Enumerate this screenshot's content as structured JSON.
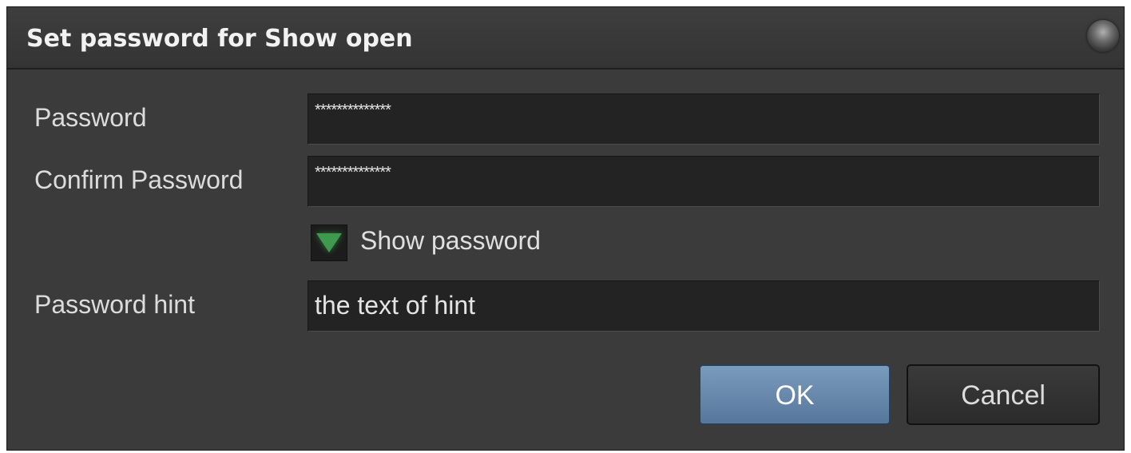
{
  "dialog": {
    "title": "Set password for Show open"
  },
  "form": {
    "password_label": "Password",
    "password_value": "**************",
    "confirm_label": "Confirm Password",
    "confirm_value": "**************",
    "show_password_label": "Show password",
    "show_password_checked": true,
    "hint_label": "Password hint",
    "hint_value": "the text of hint"
  },
  "buttons": {
    "ok_label": "OK",
    "cancel_label": "Cancel"
  },
  "colors": {
    "dialog_bg": "#3b3b3b",
    "field_bg": "#232323",
    "ok_button": "#6a8aad",
    "checkbox_check": "#3f9a50"
  },
  "icons": {
    "title_orb": "orb-icon",
    "checkbox_mark": "check-triangle-icon"
  }
}
